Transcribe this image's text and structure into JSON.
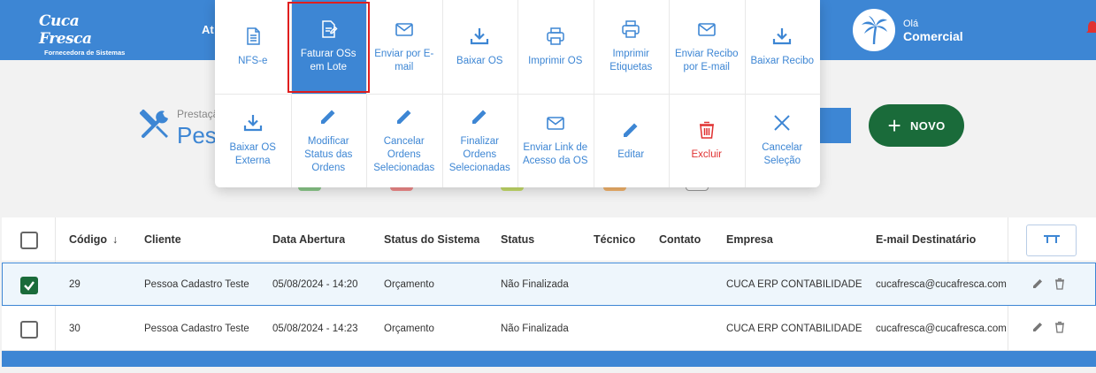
{
  "header": {
    "logo_text": "Cuca Fresca",
    "logo_tagline": "Fornecedora de Sistemas",
    "nav_item": "At",
    "greeting": "Olá",
    "user_name": "Comercial"
  },
  "page": {
    "subtitle": "Prestaçã",
    "title": "Pesc",
    "new_button": "NOVO"
  },
  "actions_menu": [
    {
      "label": "NFS-e",
      "icon": "document-icon"
    },
    {
      "label": "Faturar OSs em Lote",
      "icon": "invoice-icon",
      "selected": true
    },
    {
      "label": "Enviar por E-mail",
      "icon": "mail-icon"
    },
    {
      "label": "Baixar OS",
      "icon": "download-icon"
    },
    {
      "label": "Imprimir OS",
      "icon": "print-icon"
    },
    {
      "label": "Imprimir Etiquetas",
      "icon": "print-icon"
    },
    {
      "label": "Enviar Recibo por E-mail",
      "icon": "mail-icon"
    },
    {
      "label": "Baixar Recibo",
      "icon": "download-icon"
    },
    {
      "label": "Baixar OS Externa",
      "icon": "download-icon"
    },
    {
      "label": "Modificar Status das Ordens",
      "icon": "pencil-icon"
    },
    {
      "label": "Cancelar Ordens Selecionadas",
      "icon": "pencil-icon"
    },
    {
      "label": "Finalizar Ordens Selecionadas",
      "icon": "pencil-icon"
    },
    {
      "label": "Enviar Link de Acesso da OS",
      "icon": "mail-icon"
    },
    {
      "label": "Editar",
      "icon": "pencil-icon"
    },
    {
      "label": "Excluir",
      "icon": "trash-icon",
      "danger": true
    },
    {
      "label": "Cancelar Seleção",
      "icon": "close-icon"
    }
  ],
  "table": {
    "columns": [
      "Código",
      "Cliente",
      "Data Abertura",
      "Status do Sistema",
      "Status",
      "Técnico",
      "Contato",
      "Empresa",
      "E-mail Destinatário"
    ],
    "rows": [
      {
        "checked": true,
        "codigo": "29",
        "cliente": "Pessoa Cadastro Teste",
        "data": "05/08/2024 - 14:20",
        "status_sistema": "Orçamento",
        "status": "Não Finalizada",
        "tecnico": "",
        "contato": "",
        "empresa": "CUCA ERP CONTABILIDADE",
        "email": "cucafresca@cucafresca.com.br"
      },
      {
        "checked": false,
        "codigo": "30",
        "cliente": "Pessoa Cadastro Teste",
        "data": "05/08/2024 - 14:23",
        "status_sistema": "Orçamento",
        "status": "Não Finalizada",
        "tecnico": "",
        "contato": "",
        "empresa": "CUCA ERP CONTABILIDADE",
        "email": "cucafresca@cucafresca.com.br"
      }
    ]
  },
  "colors": {
    "primary": "#3d86d4",
    "success": "#1a6b3a",
    "danger": "#e03131",
    "highlight": "#e01e1e"
  }
}
